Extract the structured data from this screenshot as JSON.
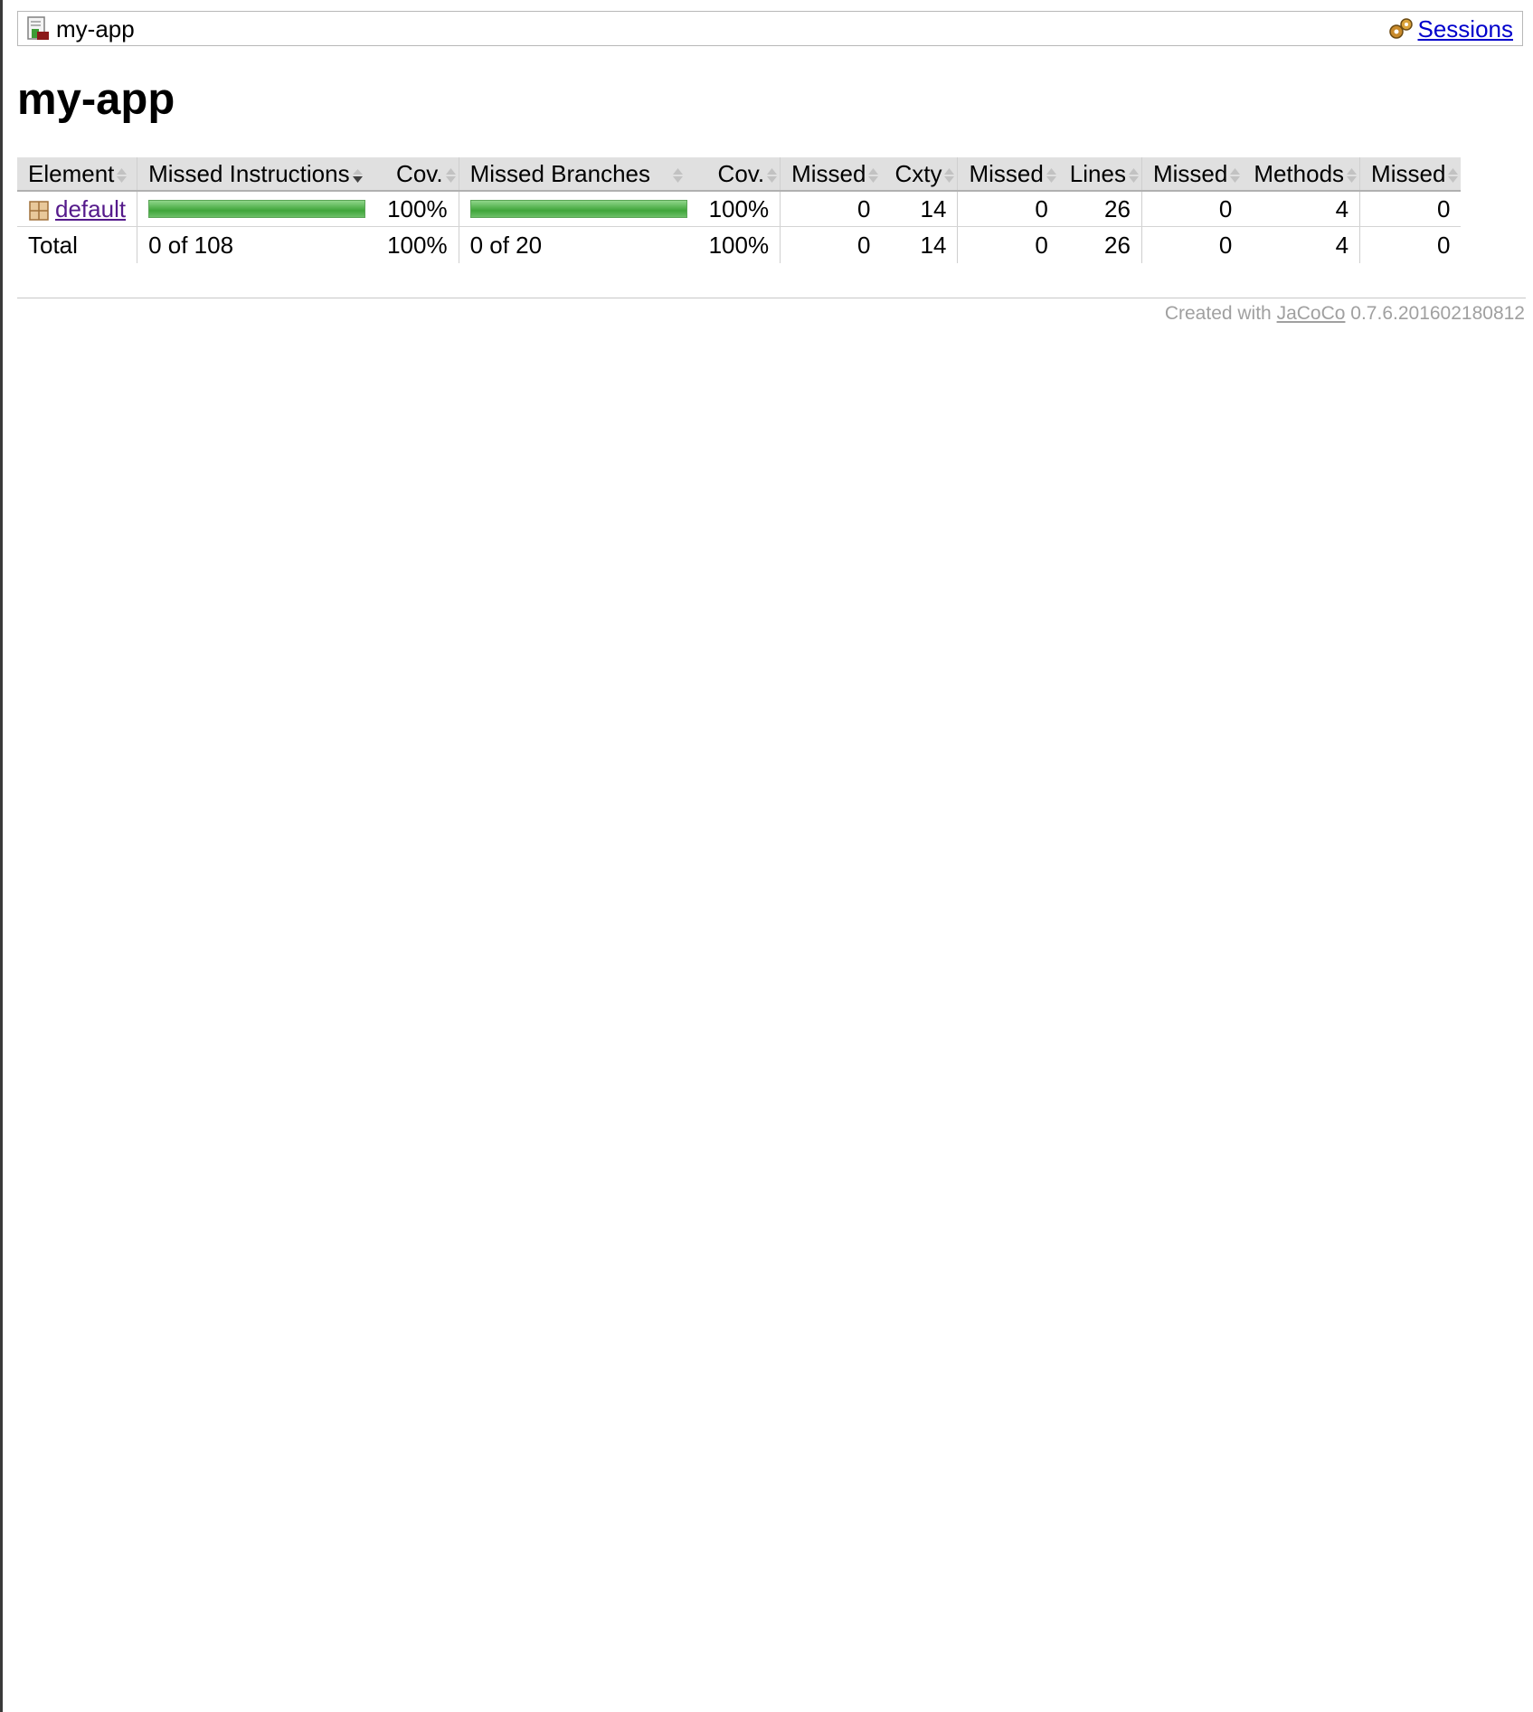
{
  "breadcrumb": {
    "current": "my-app",
    "sessions_label": "Sessions"
  },
  "page": {
    "title": "my-app"
  },
  "table": {
    "headers": {
      "element": "Element",
      "missed_instructions": "Missed Instructions",
      "cov_instructions": "Cov.",
      "missed_branches": "Missed Branches",
      "cov_branches": "Cov.",
      "missed_cxty": "Missed",
      "cxty": "Cxty",
      "missed_lines": "Missed",
      "lines": "Lines",
      "missed_methods": "Missed",
      "methods": "Methods",
      "missed_classes": "Missed"
    },
    "rows": [
      {
        "element": "default",
        "instructions_coverage": 1.0,
        "cov_instructions": "100%",
        "branches_coverage": 1.0,
        "cov_branches": "100%",
        "missed_cxty": "0",
        "cxty": "14",
        "missed_lines": "0",
        "lines": "26",
        "missed_methods": "0",
        "methods": "4",
        "missed_classes": "0"
      }
    ],
    "total": {
      "label": "Total",
      "instructions": "0 of 108",
      "cov_instructions": "100%",
      "branches": "0 of 20",
      "cov_branches": "100%",
      "missed_cxty": "0",
      "cxty": "14",
      "missed_lines": "0",
      "lines": "26",
      "missed_methods": "0",
      "methods": "4",
      "missed_classes": "0"
    },
    "sorted_column": "Missed Instructions",
    "sort_direction": "descending"
  },
  "footer": {
    "prefix": "Created with",
    "link_label": "JaCoCo",
    "version": "0.7.6.201602180812"
  },
  "colors": {
    "bar_green": "#3fa53a",
    "header_bg": "#e0e0e0",
    "link": "#0000cc",
    "visited_link": "#551a8b"
  }
}
